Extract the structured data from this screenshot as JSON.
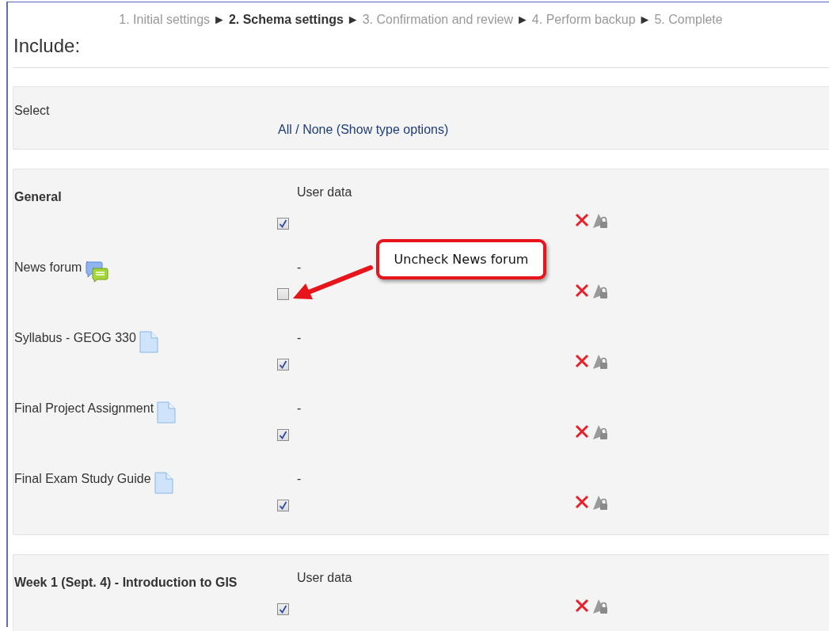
{
  "steps": [
    {
      "label": "1. Initial settings",
      "selected": false,
      "separator": "►"
    },
    {
      "label": "2. Schema settings",
      "selected": true,
      "separator": "►"
    },
    {
      "label": "3. Confirmation and review",
      "selected": false,
      "separator": "►"
    },
    {
      "label": "4. Perform backup",
      "selected": false,
      "separator": "►"
    },
    {
      "label": "5. Complete",
      "selected": false
    }
  ],
  "title": "Include:",
  "select": {
    "label": "Select",
    "all": "All",
    "divider": "/",
    "none": "None",
    "type_options": "(Show type options)"
  },
  "sections": [
    {
      "title": "General",
      "user_data": "User data",
      "checked": true,
      "items": [
        {
          "label": "News forum",
          "kind": "forum",
          "user_data": "-",
          "checked": false
        },
        {
          "label": "Syllabus - GEOG 330",
          "kind": "file",
          "user_data": "-",
          "checked": true
        },
        {
          "label": "Final Project Assignment",
          "kind": "file",
          "user_data": "-",
          "checked": true
        },
        {
          "label": "Final Exam Study Guide",
          "kind": "file",
          "user_data": "-",
          "checked": true
        }
      ]
    },
    {
      "title": "Week 1 (Sept. 4) - Introduction to GIS",
      "user_data": "User data",
      "checked": true
    }
  ],
  "annotation": {
    "text": "Uncheck News forum"
  }
}
